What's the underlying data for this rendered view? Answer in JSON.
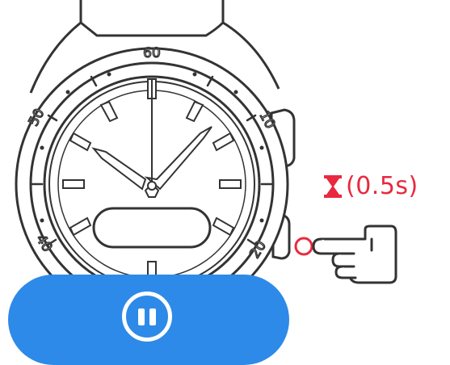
{
  "watch": {
    "bezel_numbers": [
      "60",
      "10",
      "20",
      "40",
      "50"
    ]
  },
  "instruction": {
    "duration_label": "(0.5s)",
    "hourglass_icon": "hourglass-icon",
    "hand_icon": "pointing-hand-icon",
    "target_button": "lower-right-button"
  },
  "pause_button": {
    "icon": "pause-icon",
    "color": "#2d8ae8"
  },
  "colors": {
    "accent_red": "#e8293f",
    "outline": "#333333",
    "pause_blue": "#2d8ae8"
  }
}
